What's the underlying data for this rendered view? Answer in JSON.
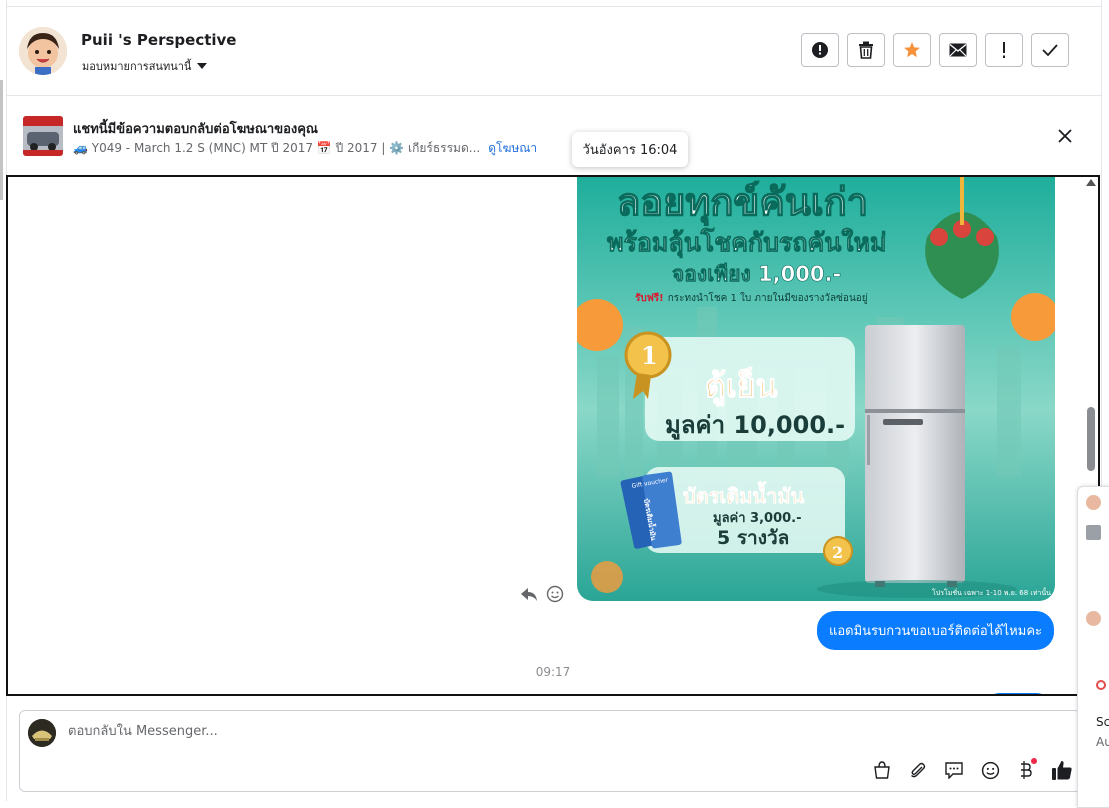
{
  "header": {
    "title": "Puii 's Perspective",
    "assign_label": "มอบหมายการสนทนานี้"
  },
  "ad_banner": {
    "title": "แชทนี้มีข้อความตอบกลับต่อโฆษณาของคุณ",
    "meta": "🚙 Y049 - March 1.2 S (MNC) MT ปี 2017 📅 ปี 2017 | ⚙️ เกียร์ธรรมด...",
    "link": "ดูโฆษณา"
  },
  "tooltip": "วันอังคาร 16:04",
  "ad_image": {
    "headline1": "ลอยทุกข์คันเก่า",
    "headline2": "พร้อมลุ้นโชคกับรถคันใหม่",
    "headline3": "จองเพียง 1,000.-",
    "freebie_prefix": "รับฟรี!",
    "freebie_text": "กระทงนำโชค 1 ใบ ภายในมีของรางวัลซ่อนอยู่",
    "prize1_rank": "1",
    "prize1_name": "ตู้เย็น",
    "prize1_value": "มูลค่า 10,000.-",
    "prize2_rank": "2",
    "prize2_name": "บัตรเติมน้ำมัน",
    "prize2_value": "มูลค่า 3,000.-",
    "prize2_count": "5 รางวัล",
    "fine_print": "โปรโมชั่น เฉพาะ 1-10 พ.ย. 68 เท่านั้น",
    "voucher_label": "Gift voucher",
    "voucher_text": "บัตรเติมน้ำมัน"
  },
  "messages": [
    {
      "sender": "page",
      "text": "แอดมินรบกวนขอเบอร์ติดต่อได้ไหมคะ"
    }
  ],
  "timestamp": "09:17",
  "composer": {
    "placeholder": "ตอบกลับใน Messenger..."
  },
  "side_panel": {
    "text1": "Sc",
    "text2": "Au"
  },
  "colors": {
    "accent": "#0a7cff",
    "star": "#f7923a",
    "link": "#216fdb"
  }
}
